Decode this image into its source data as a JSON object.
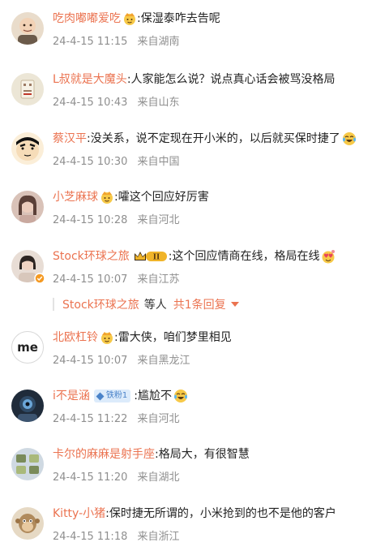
{
  "comments": [
    {
      "username": "吃肉嘟嘟爱吃",
      "badge": "crown-emoji",
      "text": "保湿泰咋去告呢",
      "date": "24-4-15",
      "time": "11:15",
      "location": "来自湖南",
      "avatar_colors": [
        "#e9dccb",
        "#6b5a4a"
      ]
    },
    {
      "username": "L叔就是大魔头",
      "text": "人家能怎么说？说点真心话会被骂没格局",
      "date": "24-4-15",
      "time": "10:43",
      "location": "来自山东",
      "avatar_colors": [
        "#ece6d6",
        "#9c7a63"
      ]
    },
    {
      "username": "蔡汉平",
      "text": "没关系，说不定现在开小米的，以后就买保时捷了",
      "emoji": "laugh-cry-emoji",
      "date": "24-4-15",
      "time": "10:30",
      "location": "来自中国",
      "avatar_colors": [
        "#f6dcb8",
        "#111111"
      ]
    },
    {
      "username": "小芝麻球",
      "badge": "crown-emoji",
      "text": "嚯这个回应好厉害",
      "date": "24-4-15",
      "time": "10:28",
      "location": "来自河北",
      "avatar_colors": [
        "#c9a99f",
        "#5b4038"
      ]
    },
    {
      "username": "Stock环球之旅",
      "vip_label": "II",
      "text": "这个回应情商在线，格局在线",
      "emoji": "love-emoji",
      "date": "24-4-15",
      "time": "10:07",
      "location": "来自江苏",
      "avatar_colors": [
        "#d8c7bb",
        "#2d2522"
      ]
    },
    {
      "username": "北欧杠铃",
      "badge": "crown-emoji",
      "text": "雷大侠，咱们梦里相见",
      "date": "24-4-15",
      "time": "10:07",
      "location": "来自黑龙江",
      "avatar_text": "me"
    },
    {
      "username": "i不是涵",
      "fan_badge": "铁粉1",
      "text": "尴尬不",
      "emoji": "laugh-cry-emoji",
      "date": "24-4-15",
      "time": "11:22",
      "location": "来自河北",
      "avatar_colors": [
        "#1f2b3a",
        "#6aa6d8"
      ]
    },
    {
      "username": "卡尔的麻麻是射手座",
      "text": "格局大，有很智慧",
      "date": "24-4-15",
      "time": "11:20",
      "location": "来自湖北",
      "avatar_colors": [
        "#cfd9e2",
        "#7a8b5a"
      ]
    },
    {
      "username": "Kitty-小猪",
      "text": "保时捷无所谓的，小米抢到的也不是他的客户",
      "date": "24-4-15",
      "time": "11:18",
      "location": "来自浙江",
      "avatar_colors": [
        "#e6d9c4",
        "#7c6040"
      ]
    }
  ],
  "sub_reply": {
    "name": "Stock环球之旅",
    "suffix": "等人",
    "count": "共1条回复"
  },
  "separator": ":",
  "colors": {
    "username": "#eb7350",
    "meta": "#8f8f8f",
    "text": "#222222"
  }
}
